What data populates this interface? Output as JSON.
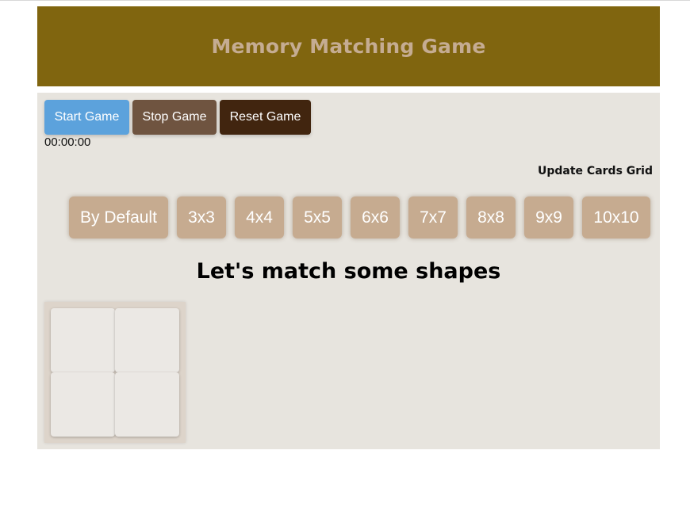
{
  "header": {
    "title": "Memory Matching Game"
  },
  "controls": {
    "start_label": "Start Game",
    "stop_label": "Stop Game",
    "reset_label": "Reset Game",
    "timer": "00:00:00"
  },
  "grid_options": {
    "label": "Update Cards Grid",
    "items": [
      "By Default",
      "3x3",
      "4x4",
      "5x5",
      "6x6",
      "7x7",
      "8x8",
      "9x9",
      "10x10"
    ]
  },
  "board": {
    "title": "Let's match some shapes",
    "rows": 2,
    "cols": 2
  },
  "colors": {
    "header_bg": "#80650f",
    "title_text": "#c5ac92",
    "panel_bg": "#e7e4de",
    "start_btn": "#5ca2dc",
    "stop_btn": "#6f5440",
    "reset_btn": "#41250f",
    "grid_btn": "#c6ab90"
  }
}
